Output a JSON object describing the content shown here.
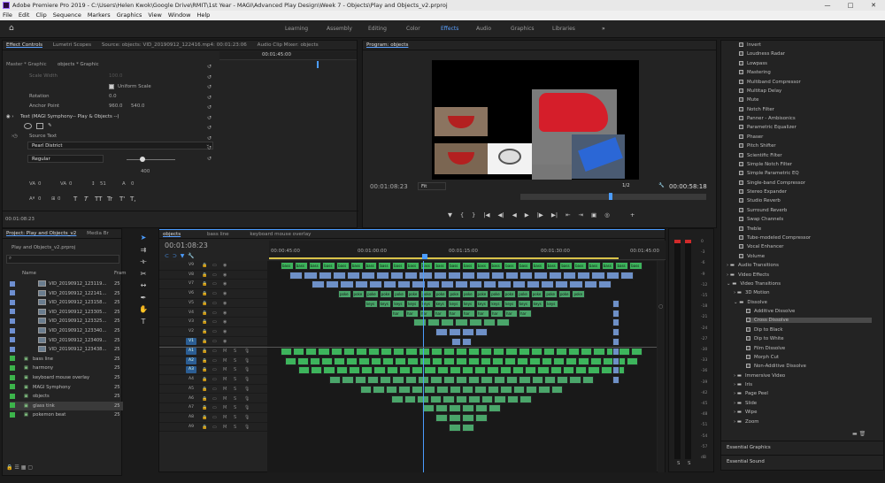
{
  "titlebar": {
    "title": "Adobe Premiere Pro 2019 - C:\\Users\\Helen Kwok\\Google Drive\\RMIT\\1st Year - MAGI\\Advanced Play Design\\Week 7 - Objects\\Play and Objects_v2.prproj"
  },
  "window_controls": {
    "minimize": "—",
    "maximize": "□",
    "close": "✕"
  },
  "menu": [
    "File",
    "Edit",
    "Clip",
    "Sequence",
    "Markers",
    "Graphics",
    "View",
    "Window",
    "Help"
  ],
  "workspaces": {
    "home": "⌂",
    "tabs": [
      "Learning",
      "Assembly",
      "Editing",
      "Color",
      "Effects",
      "Audio",
      "Graphics",
      "Libraries"
    ],
    "active": "Effects",
    "more": "»"
  },
  "effect_controls": {
    "tabs": [
      "Effect Controls",
      "Lumetri Scopes",
      "Source: objects: VID_20190912_122416.mp4: 00:01:23:06",
      "Audio Clip Mixer: objects"
    ],
    "master": "Master * Graphic",
    "sequence": "objects * Graphic",
    "ruler_time": "00:01:45:00",
    "scale_width": "Scale Width",
    "scale_width_val": "100.0",
    "uniform_scale": "Uniform Scale",
    "rotation": "Rotation",
    "rotation_val": "0.0",
    "anchor_point": "Anchor Point",
    "anchor_x": "960.0",
    "anchor_y": "540.0",
    "text_layer": "Text (MAGI Symphony-- Play & Objects --)",
    "source_text": "Source Text",
    "font": "Pearl District",
    "style": "Regular",
    "font_size": "400",
    "tracking_a": "0",
    "tracking_b": "0",
    "kern": "51",
    "lead": "0",
    "baseline": "0",
    "tsume": "0",
    "type_buttons": [
      "T",
      "T",
      "TT",
      "Tr",
      "T'",
      "T,"
    ],
    "timecode": "00:01:08:23"
  },
  "program": {
    "title": "Program: objects",
    "timecode": "00:01:08:23",
    "fit": "Fit",
    "resolution": "1/2",
    "duration": "00:00:58:18"
  },
  "transport": [
    "▼",
    "{",
    "}",
    "|◀",
    "◀|",
    "◀",
    "▶",
    "|▶",
    "▶|",
    "⇤",
    "⇥",
    "▣",
    "◎",
    "+"
  ],
  "project": {
    "tabs": [
      "Project: Play and Objects_v2",
      "Media Br"
    ],
    "file": "Play and Objects_v2.prproj",
    "col_name": "Name",
    "col_frame": "Fram",
    "items": [
      {
        "name": "VID_20190912_123119...",
        "rate": "25",
        "color": "#6e8fd0",
        "thumb": true
      },
      {
        "name": "VID_20190912_122141...",
        "rate": "25",
        "color": "#6e8fd0",
        "thumb": true
      },
      {
        "name": "VID_20190912_123158...",
        "rate": "25",
        "color": "#6e8fd0",
        "thumb": true
      },
      {
        "name": "VID_20190912_123305...",
        "rate": "25",
        "color": "#6e8fd0",
        "thumb": true
      },
      {
        "name": "VID_20190912_123325...",
        "rate": "25",
        "color": "#6e8fd0",
        "thumb": true
      },
      {
        "name": "VID_20190912_123340...",
        "rate": "25",
        "color": "#6e8fd0",
        "thumb": true
      },
      {
        "name": "VID_20190912_123409...",
        "rate": "25",
        "color": "#6e8fd0",
        "thumb": true
      },
      {
        "name": "VID_20190912_123438...",
        "rate": "25",
        "color": "#6e8fd0",
        "thumb": true
      },
      {
        "name": "bass line",
        "rate": "25",
        "color": "#3cb44b",
        "thumb": false
      },
      {
        "name": "harmony",
        "rate": "25",
        "color": "#3cb44b",
        "thumb": false
      },
      {
        "name": "keyboard mouse overlay",
        "rate": "25",
        "color": "#3cb44b",
        "thumb": false
      },
      {
        "name": "MAGI Symphony",
        "rate": "25",
        "color": "#3cb44b",
        "thumb": false
      },
      {
        "name": "objects",
        "rate": "25",
        "color": "#3cb44b",
        "thumb": false
      },
      {
        "name": "glass tink",
        "rate": "25",
        "color": "#3cb44b",
        "thumb": false
      },
      {
        "name": "pokemon beat",
        "rate": "25",
        "color": "#3cb44b",
        "thumb": false
      }
    ]
  },
  "timeline": {
    "tabs": [
      "objects",
      "bass line",
      "keyboard mouse overlay"
    ],
    "timecode": "00:01:08:23",
    "ruler": [
      "00:00:45:00",
      "00:01:00:00",
      "00:01:15:00",
      "00:01:30:00",
      "00:01:45:00"
    ],
    "video_tracks": [
      "V9",
      "V8",
      "V7",
      "V6",
      "V5",
      "V4",
      "V3",
      "V2",
      "V1"
    ],
    "audio_tracks": [
      "A1",
      "A2",
      "A3",
      "A4",
      "A5",
      "A6",
      "A7",
      "A8",
      "A9"
    ],
    "track_labels": {
      "m": "M",
      "s": "S"
    },
    "clip_labels": {
      "har": "har",
      "keys": "keys",
      "poke": "poke",
      "bass": "bass"
    }
  },
  "meter": {
    "scale": [
      "0",
      "-3",
      "-6",
      "-9",
      "-12",
      "-15",
      "-18",
      "-21",
      "-24",
      "-27",
      "-30",
      "-33",
      "-36",
      "-39",
      "-42",
      "-45",
      "-48",
      "-51",
      "-54",
      "-57",
      "dB"
    ],
    "s_left": "S",
    "s_right": "S"
  },
  "effects": {
    "audio_effects": [
      "Invert",
      "Loudness Radar",
      "Lowpass",
      "Mastering",
      "Multiband Compressor",
      "Multitap Delay",
      "Mute",
      "Notch Filter",
      "Panner - Ambisonics",
      "Parametric Equalizer",
      "Phaser",
      "Pitch Shifter",
      "Scientific Filter",
      "Simple Notch Filter",
      "Simple Parametric EQ",
      "Single-band Compressor",
      "Stereo Expander",
      "Studio Reverb",
      "Surround Reverb",
      "Swap Channels",
      "Treble",
      "Tube-modeled Compressor",
      "Vocal Enhancer",
      "Volume"
    ],
    "folders": [
      "Audio Transitions",
      "Video Effects",
      "Video Transitions",
      "3D Motion",
      "Dissolve"
    ],
    "dissolve": [
      "Additive Dissolve",
      "Cross Dissolve",
      "Dip to Black",
      "Dip to White",
      "Film Dissolve",
      "Morph Cut",
      "Non-Additive Dissolve"
    ],
    "selected": "Cross Dissolve",
    "more_folders": [
      "Immersive Video",
      "Iris",
      "Page Peel",
      "Slide",
      "Wipe",
      "Zoom"
    ],
    "bottom": [
      "Essential Graphics",
      "Essential Sound"
    ]
  }
}
